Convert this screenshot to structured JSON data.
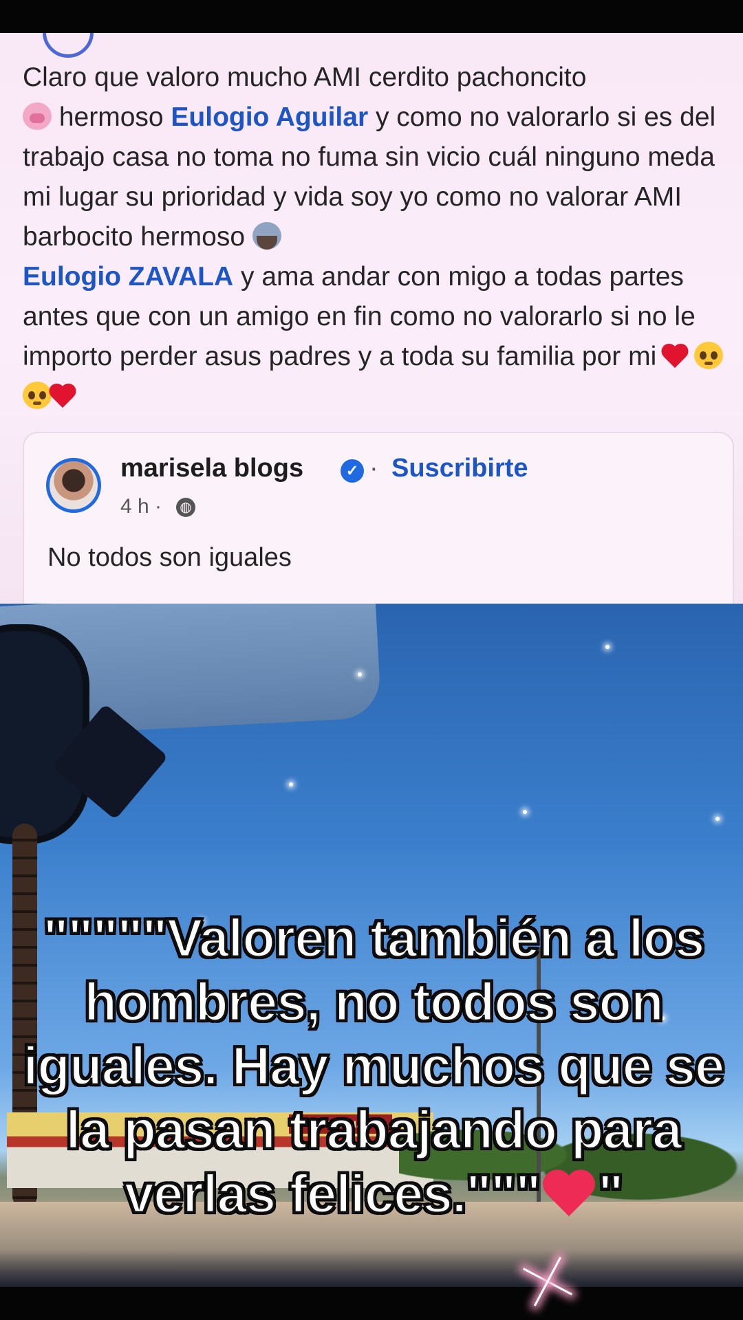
{
  "post": {
    "line1": "Claro que valoro mucho AMI cerdito pachoncito",
    "line2_after_emoji": " hermoso ",
    "mention1": "Eulogio Aguilar",
    "line2_rest": " y como no valorarlo si es del trabajo casa no toma no fuma  sin vicio cuál ninguno meda mi lugar su prioridad y vida soy yo como no valorar AMI barbocito hermoso ",
    "mention2": "Eulogio ZAVALA",
    "line_rest": "  y ama andar con migo a todas partes antes que con un amigo en fin como no valorarlo si no le importo perder asus padres y a toda su  familia por mi ",
    "emojis": [
      "pig-face-icon",
      "bearded-man-icon",
      "red-heart-icon",
      "pleading-face-icon",
      "pleading-face-icon",
      "red-heart-icon"
    ]
  },
  "shared_post": {
    "author": "marisela blogs",
    "separator": "·",
    "subscribe_label": "Suscribirte",
    "time": "4 h ·",
    "text": "No todos son iguales"
  },
  "overlay": {
    "quote": "\"\"\"\"\"Valoren también a los hombres, no todos son iguales. Hay muchos que se la pasan trabajando para verlas felices.\"\"\"",
    "quote_end": "\""
  },
  "photo": {
    "sign_text": "ARMACIA"
  },
  "colors": {
    "mention": "#1c55c6",
    "verified": "#1f6ae0",
    "post_bg": "#f9e8f6",
    "heart": "#ee2b55"
  }
}
